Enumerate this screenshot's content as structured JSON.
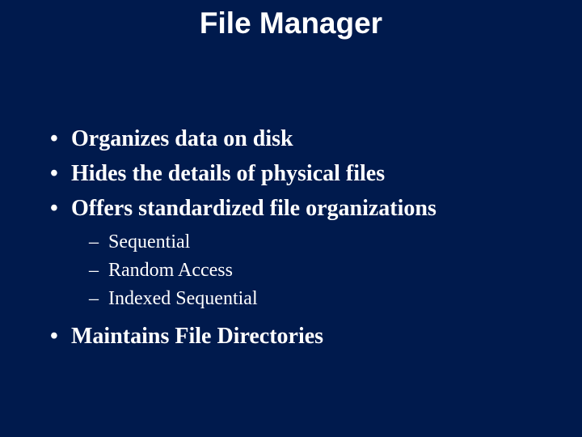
{
  "title": "File Manager",
  "bullets": {
    "b0": "Organizes data on disk",
    "b1": "Hides the details of physical files",
    "b2": "Offers standardized file organizations",
    "b2_sub": {
      "s0": "Sequential",
      "s1": "Random Access",
      "s2": "Indexed Sequential"
    },
    "b3": "Maintains File Directories"
  }
}
